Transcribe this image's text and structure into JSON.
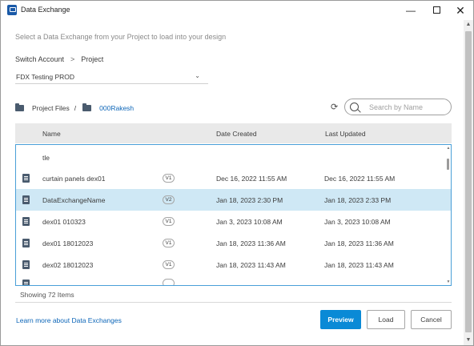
{
  "window": {
    "title": "Data Exchange",
    "minimize_glyph": "—",
    "close_glyph": "✕"
  },
  "instruction": "Select a Data Exchange from your Project to load into your design",
  "breadcrumb": {
    "account": "Switch Account",
    "separator": ">",
    "project": "Project"
  },
  "hub": {
    "selected": "FDX Testing PROD"
  },
  "path": {
    "root": "Project Files",
    "separator": "/",
    "current": "000Rakesh"
  },
  "search": {
    "placeholder": "Search by Name"
  },
  "table": {
    "columns": [
      "Name",
      "Date Created",
      "Last Updated"
    ],
    "rows": [
      {
        "name": "",
        "version": "",
        "created": "",
        "updated": ""
      },
      {
        "name": "tle",
        "version": "",
        "created": "",
        "updated": ""
      },
      {
        "name": "curtain panels dex01",
        "version": "V1",
        "created": "Dec 16, 2022 11:55 AM",
        "updated": "Dec 16, 2022 11:55 AM"
      },
      {
        "name": "DataExchangeName",
        "version": "V2",
        "created": "Jan 18, 2023 2:30 PM",
        "updated": "Jan 18, 2023 2:33 PM",
        "selected": true
      },
      {
        "name": "dex01 010323",
        "version": "V1",
        "created": "Jan 3, 2023 10:08 AM",
        "updated": "Jan 3, 2023 10:08 AM"
      },
      {
        "name": "dex01 18012023",
        "version": "V1",
        "created": "Jan 18, 2023 11:36 AM",
        "updated": "Jan 18, 2023 11:36 AM"
      },
      {
        "name": "dex02 18012023",
        "version": "V1",
        "created": "Jan 18, 2023 11:43 AM",
        "updated": "Jan 18, 2023 11:43 AM"
      },
      {
        "name": "",
        "version": "",
        "created": "",
        "updated": ""
      }
    ]
  },
  "status": {
    "showing": "Showing 72 Items"
  },
  "footer": {
    "learn_more": "Learn more about Data Exchanges",
    "preview_label": "Preview",
    "load_label": "Load",
    "cancel_label": "Cancel"
  },
  "colors": {
    "accent": "#0a8ad6",
    "link": "#0d66b8",
    "selected_row": "#cfe8f5",
    "table_border": "#4a9fd8"
  }
}
